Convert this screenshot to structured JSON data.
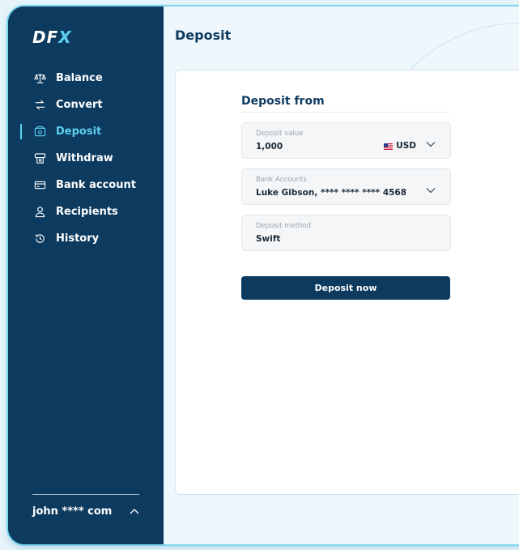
{
  "brand": {
    "logo_main": "DF",
    "logo_accent": "X"
  },
  "sidebar": {
    "items": [
      {
        "label": "Balance",
        "icon": "scale-icon"
      },
      {
        "label": "Convert",
        "icon": "convert-icon"
      },
      {
        "label": "Deposit",
        "icon": "wallet-icon",
        "active": true
      },
      {
        "label": "Withdraw",
        "icon": "atm-icon"
      },
      {
        "label": "Bank account",
        "icon": "card-icon"
      },
      {
        "label": "Recipients",
        "icon": "person-icon"
      },
      {
        "label": "History",
        "icon": "history-icon"
      }
    ],
    "user": {
      "email": "john **** com",
      "toggle_icon": "chevron-up-icon"
    }
  },
  "header": {
    "title": "Deposit"
  },
  "form": {
    "title": "Deposit from",
    "deposit_value": {
      "label": "Deposit value",
      "value": "1,000",
      "currency": "USD",
      "flag_icon": "us-flag-icon"
    },
    "bank_accounts": {
      "label": "Bank Accounts",
      "value": "Luke Gibson, **** **** **** 4568"
    },
    "deposit_method": {
      "label": "Deposit method",
      "value": "Swift"
    },
    "submit_label": "Deposit now"
  },
  "colors": {
    "sidebar_bg": "#0d3a5f",
    "accent": "#5bd0f2",
    "main_bg": "#eef8fc",
    "button_bg": "#0d3a5f"
  }
}
